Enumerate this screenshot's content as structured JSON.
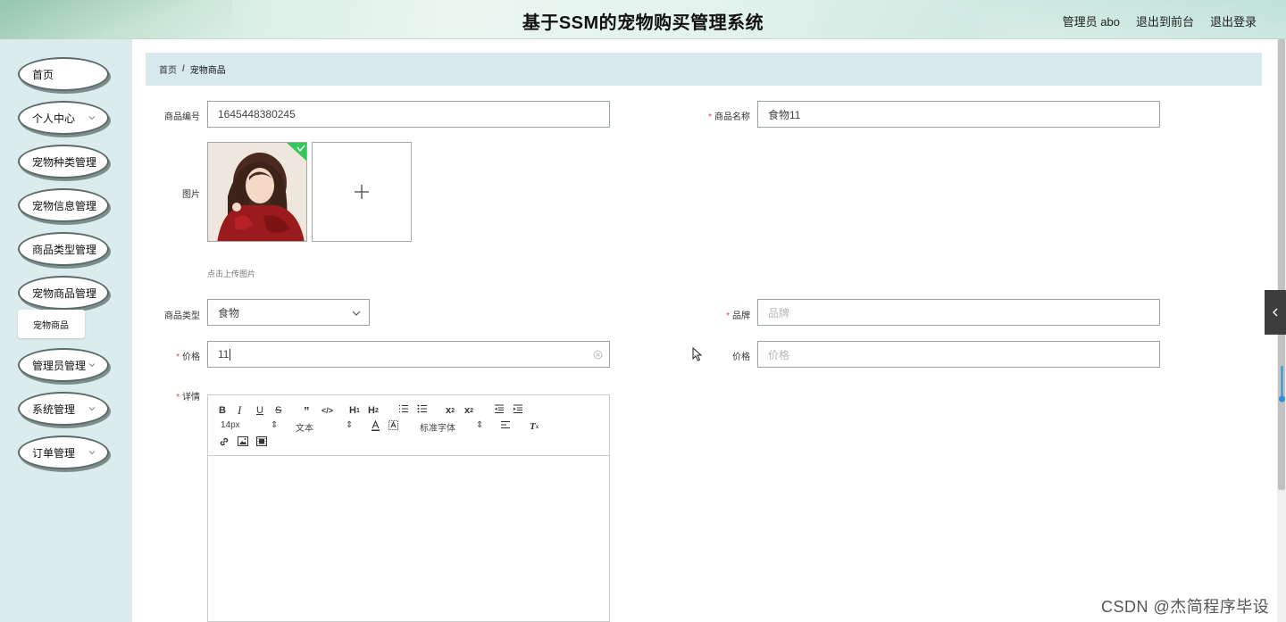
{
  "header": {
    "title": "基于SSM的宠物购买管理系统",
    "links": [
      "管理员 abo",
      "退出到前台",
      "退出登录"
    ]
  },
  "sidebar": {
    "items": [
      {
        "label": "首页",
        "has_chevron": false
      },
      {
        "label": "个人中心",
        "has_chevron": true
      },
      {
        "label": "宠物种类管理",
        "has_chevron": true
      },
      {
        "label": "宠物信息管理",
        "has_chevron": true
      },
      {
        "label": "商品类型管理",
        "has_chevron": true
      },
      {
        "label": "宠物商品管理",
        "has_chevron": true
      },
      {
        "label": "管理员管理",
        "has_chevron": true
      },
      {
        "label": "系统管理",
        "has_chevron": true
      },
      {
        "label": "订单管理",
        "has_chevron": true
      }
    ],
    "sub_item": "宠物商品"
  },
  "breadcrumb": {
    "home": "首页",
    "separator": "/",
    "current": "宠物商品"
  },
  "form": {
    "product_code": {
      "label": "商品编号",
      "value": "1645448380245"
    },
    "product_name": {
      "label": "商品名称",
      "value": "食物11",
      "required": true
    },
    "image": {
      "label": "图片",
      "tip": "点击上传图片"
    },
    "product_type": {
      "label": "商品类型",
      "value": "食物"
    },
    "brand": {
      "label": "品牌",
      "placeholder": "品牌",
      "required": true
    },
    "price": {
      "label": "价格",
      "value": "11",
      "required": true
    },
    "price2": {
      "label": "价格",
      "placeholder": "价格"
    },
    "details": {
      "label": "详情",
      "required": true
    }
  },
  "editor": {
    "font_size": "14px",
    "heading": "文本",
    "font_family": "标准字体"
  },
  "watermark": "CSDN @杰简程序毕设",
  "colors": {
    "accent": "#dcebed",
    "required": "#e2484c",
    "uploaded": "#34c759"
  }
}
